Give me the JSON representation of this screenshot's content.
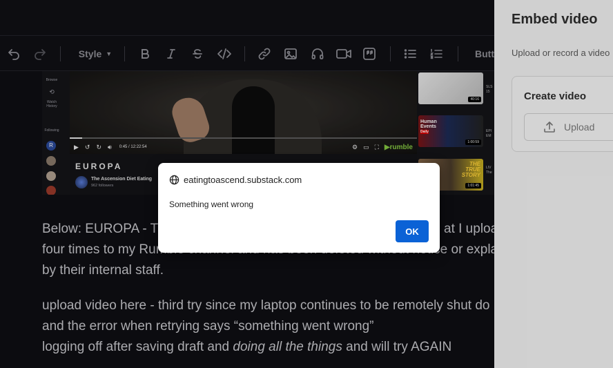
{
  "toolbar": {
    "style_label": "Style",
    "butt_label": "Butt"
  },
  "video_embed": {
    "sidebar": {
      "browse": "Browse",
      "watch_history_line1": "Watch",
      "watch_history_line2": "History",
      "following": "Following"
    },
    "time": "0:45 / 12:22:54",
    "rumble_label": "rumble",
    "channel_name": "EUROPA",
    "channel_title": "The Ascension Diet Eating",
    "followers": "962 followers",
    "thumbnails": [
      {
        "duration": "40:16",
        "side_line1": "SLS",
        "side_line2": "15"
      },
      {
        "duration": "1:00:59",
        "title_line1": "Human",
        "title_line2": "Events",
        "title_line3": "Daily",
        "side_line1": "EPI",
        "side_line2": "EM"
      },
      {
        "duration": "1:01:45",
        "title_line1": "THE",
        "title_line2": "TRUE",
        "title_line3": "STORY",
        "side_line1": "LIV",
        "side_line2": "The"
      }
    ]
  },
  "article": {
    "p1_line1": "Below: EUROPA - Th",
    "p1_line1_right": "at I uploa",
    "p1_line2": "four times to my Rumble channel and has been deleted without notice or expla",
    "p1_line3": "by their internal staff.",
    "p2_line1": "upload video here - third try since my laptop continues to be remotely shut do",
    "p2_line2": "and the error when retrying says “something went wrong”",
    "p2_line3_a": "logging off after saving draft and ",
    "p2_line3_em": "doing all the things",
    "p2_line3_b": " and will try AGAIN"
  },
  "panel": {
    "title": "Embed video",
    "subtitle": "Upload or record a video",
    "card_title": "Create video",
    "upload_label": "Upload"
  },
  "dialog": {
    "origin": "eatingtoascend.substack.com",
    "message": "Something went wrong",
    "ok_label": "OK"
  },
  "colors": {
    "editor_bg": "#0f0f13",
    "dialog_button": "#0b62d6",
    "panel_bg": "#f3f3f3",
    "rumble_green": "#85c742"
  }
}
